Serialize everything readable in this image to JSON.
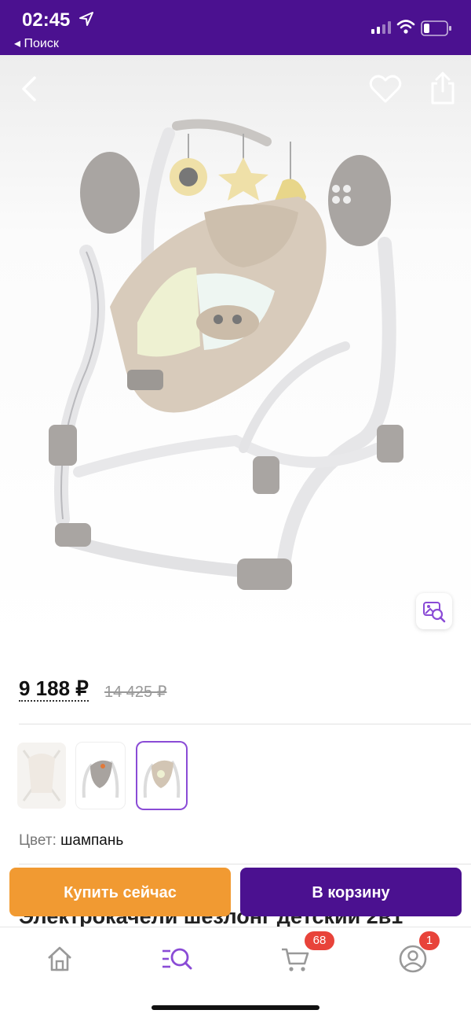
{
  "status_bar": {
    "time": "02:45",
    "back_app_label": "◂ Поиск",
    "icons": [
      "location-arrow-icon",
      "cellular-signal-icon",
      "wifi-icon",
      "battery-icon"
    ]
  },
  "product": {
    "image_icon": "baby-swing-photo",
    "price": "9 188 ₽",
    "old_price": "14 425 ₽",
    "color_label": "Цвет:",
    "color_value": "шампань",
    "title_peek": "Электрокачели шезлонг детский 2в1",
    "thumbnails": [
      "thumb-1",
      "thumb-2",
      "thumb-3"
    ],
    "selected_thumbnail": 3
  },
  "actions": {
    "buy_now": "Купить сейчас",
    "add_to_cart": "В корзину"
  },
  "tabbar": {
    "items": [
      "home-icon",
      "catalog-search-icon",
      "cart-icon",
      "profile-icon"
    ],
    "cart_badge": "68",
    "profile_badge": "1",
    "accent": "#8a4bd6"
  },
  "colors": {
    "brand": "#4b1190",
    "buy_now": "#f19a32",
    "badge": "#e8433a"
  }
}
